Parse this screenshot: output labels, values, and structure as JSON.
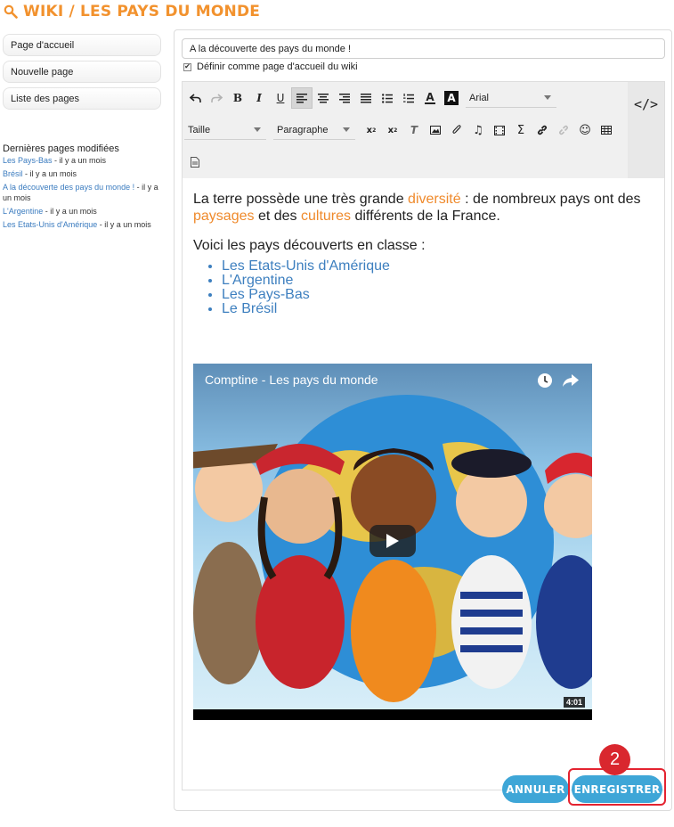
{
  "header": {
    "title": "WIKI / LES PAYS DU MONDE",
    "icon": "search-icon",
    "accent": "#f2922e"
  },
  "sidebar": {
    "buttons": [
      "Page d'accueil",
      "Nouvelle page",
      "Liste des pages"
    ],
    "recent_title": "Dernières pages modifiées",
    "recent": [
      {
        "link": "Les Pays-Bas",
        "time": " - il y a un mois"
      },
      {
        "link": "Brésil",
        "time": " - il y a un mois"
      },
      {
        "link": "A la découverte des pays du monde !",
        "time": " - il y a un mois"
      },
      {
        "link": "L'Argentine",
        "time": " - il y a un mois"
      },
      {
        "link": "Les Etats-Unis d'Amérique",
        "time": " - il y a un mois"
      }
    ]
  },
  "form": {
    "title_value": "A la découverte des pays du monde !",
    "homepage_label": "Définir comme page d'accueil du wiki",
    "homepage_checked": true
  },
  "toolbar": {
    "font_select": "Arial",
    "size_select": "Taille",
    "format_select": "Paragraphe",
    "code_label": "</>"
  },
  "content": {
    "p1_a": "La terre possède une très grande ",
    "p1_b": "diversité",
    "p1_c": " : de nombreux pays ont des ",
    "p1_d": "paysages",
    "p1_e": " et des ",
    "p1_f": "cultures",
    "p1_g": " différents de la France.",
    "p2": "Voici les pays découverts en classe :",
    "countries": [
      "Les Etats-Unis d'Amérique",
      "L'Argentine",
      "Les Pays-Bas",
      "Le Brésil"
    ]
  },
  "video": {
    "title": "Comptine - Les pays du monde",
    "duration": "4:01"
  },
  "actions": {
    "cancel": "ANNULER",
    "save": "ENREGISTRER"
  },
  "callout": {
    "number": "2",
    "color": "#d9272e"
  },
  "colors": {
    "link": "#3a7bbf",
    "button": "#3ea6d7",
    "highlight_text": "#ef8a2c"
  }
}
